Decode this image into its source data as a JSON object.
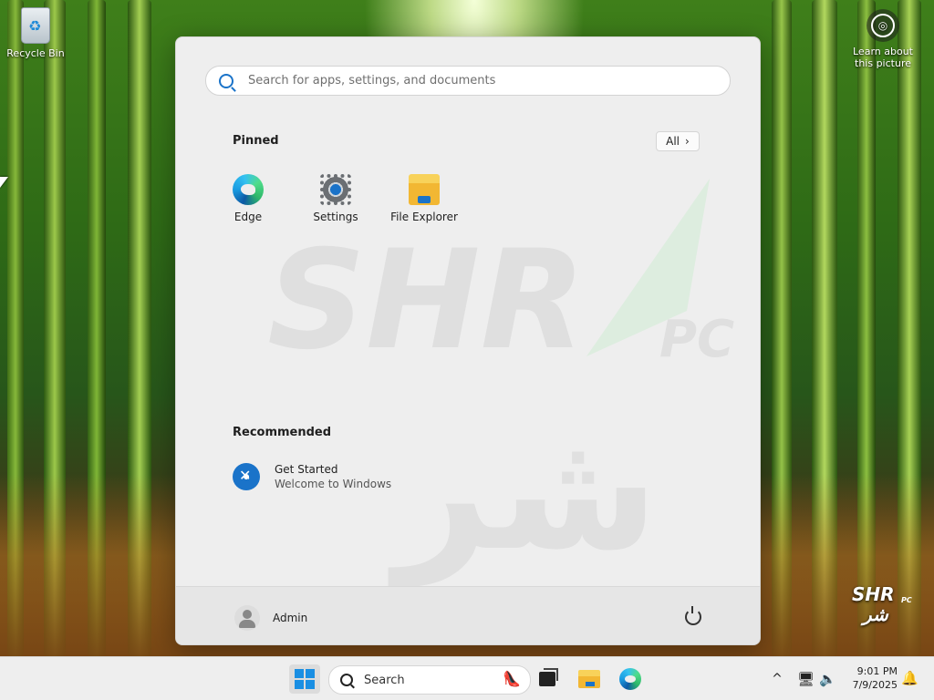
{
  "desktop": {
    "recycle_bin_label": "Recycle Bin",
    "learn_label_line1": "Learn about",
    "learn_label_line2": "this picture",
    "brand_top": "SHR",
    "brand_bottom": "شر",
    "brand_pc": "PC"
  },
  "start_menu": {
    "search_placeholder": "Search for apps, settings, and documents",
    "pinned_title": "Pinned",
    "all_button_label": "All",
    "pinned_apps": [
      {
        "label": "Edge",
        "icon": "edge-icon"
      },
      {
        "label": "Settings",
        "icon": "gear-icon"
      },
      {
        "label": "File Explorer",
        "icon": "folder-icon"
      }
    ],
    "recommended_title": "Recommended",
    "recommended": [
      {
        "title": "Get Started",
        "subtitle": "Welcome to Windows",
        "icon": "get-started-icon"
      }
    ],
    "user_name": "Admin"
  },
  "taskbar": {
    "search_label": "Search",
    "time": "9:01 PM",
    "date": "7/9/2025"
  },
  "colors": {
    "accent": "#1a73c9",
    "windows_blue": "#1a8fe3",
    "menu_bg": "#eeeeee",
    "watermark_gray": "#c9c9c9",
    "watermark_green": "#d5ecd9"
  }
}
